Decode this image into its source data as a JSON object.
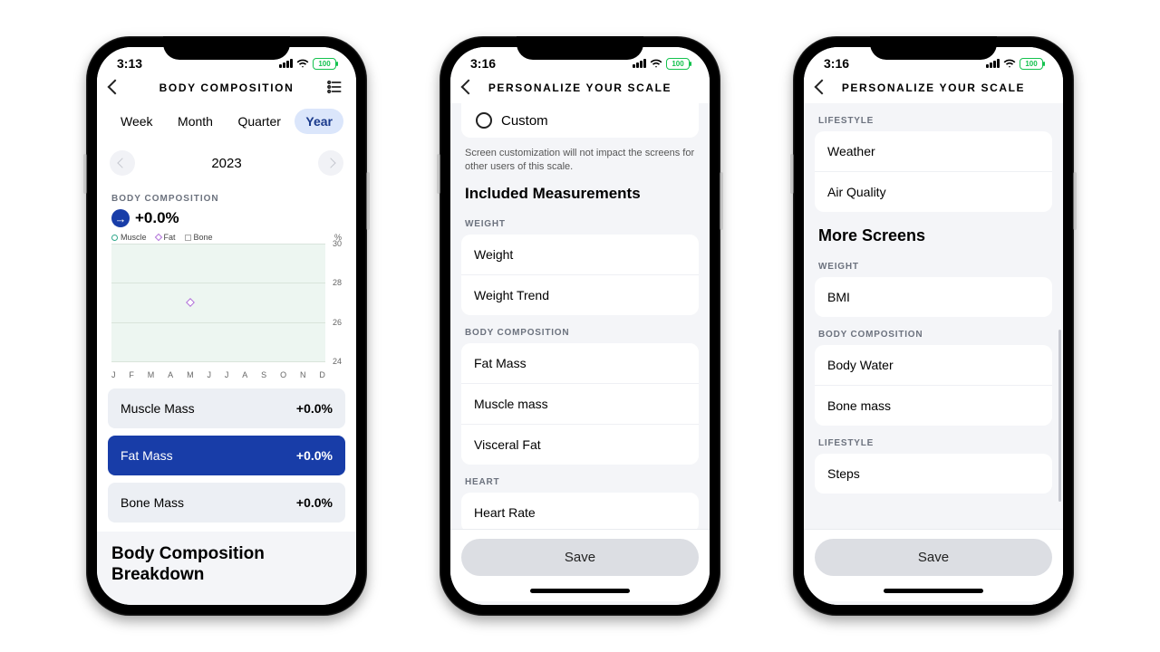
{
  "status": {
    "battery_label": "100"
  },
  "screen1": {
    "time": "3:13",
    "title": "BODY COMPOSITION",
    "tabs": [
      "Week",
      "Month",
      "Quarter",
      "Year"
    ],
    "active_tab_index": 3,
    "year": "2023",
    "section_label": "BODY COMPOSITION",
    "delta": "+0.0%",
    "legend": {
      "muscle": "Muscle",
      "fat": "Fat",
      "bone": "Bone",
      "unit": "%"
    },
    "metrics": [
      {
        "label": "Muscle Mass",
        "value": "+0.0%"
      },
      {
        "label": "Fat Mass",
        "value": "+0.0%"
      },
      {
        "label": "Bone Mass",
        "value": "+0.0%"
      }
    ],
    "active_metric_index": 1,
    "breakdown_heading": "Body Composition Breakdown"
  },
  "screen2": {
    "time": "3:16",
    "title": "PERSONALIZE YOUR SCALE",
    "custom_label": "Custom",
    "note": "Screen customization will not impact the screens for other users of this scale.",
    "included_heading": "Included Measurements",
    "groups": [
      {
        "label": "WEIGHT",
        "items": [
          "Weight",
          "Weight Trend"
        ]
      },
      {
        "label": "BODY COMPOSITION",
        "items": [
          "Fat Mass",
          "Muscle mass",
          "Visceral Fat"
        ]
      },
      {
        "label": "HEART",
        "items": [
          "Heart Rate"
        ]
      }
    ],
    "save_label": "Save"
  },
  "screen3": {
    "time": "3:16",
    "title": "PERSONALIZE YOUR SCALE",
    "top_group": {
      "label": "LIFESTYLE",
      "items": [
        "Weather",
        "Air Quality"
      ]
    },
    "more_heading": "More Screens",
    "groups": [
      {
        "label": "WEIGHT",
        "items": [
          "BMI"
        ]
      },
      {
        "label": "BODY COMPOSITION",
        "items": [
          "Body Water",
          "Bone mass"
        ]
      },
      {
        "label": "LIFESTYLE",
        "items": [
          "Steps"
        ]
      }
    ],
    "save_label": "Save"
  },
  "chart_data": {
    "type": "line",
    "title": "Body Composition",
    "xlabel": "",
    "ylabel": "%",
    "ylim": [
      24,
      30
    ],
    "y_ticks": [
      24,
      26,
      28,
      30
    ],
    "categories": [
      "J",
      "F",
      "M",
      "A",
      "M",
      "J",
      "J",
      "A",
      "S",
      "O",
      "N",
      "D"
    ],
    "series": [
      {
        "name": "Muscle",
        "values": [
          null,
          null,
          null,
          null,
          null,
          null,
          null,
          null,
          null,
          null,
          null,
          null
        ]
      },
      {
        "name": "Fat",
        "values": [
          null,
          null,
          null,
          null,
          27,
          null,
          null,
          null,
          null,
          null,
          null,
          null
        ]
      },
      {
        "name": "Bone",
        "values": [
          null,
          null,
          null,
          null,
          null,
          null,
          null,
          null,
          null,
          null,
          null,
          null
        ]
      }
    ]
  }
}
